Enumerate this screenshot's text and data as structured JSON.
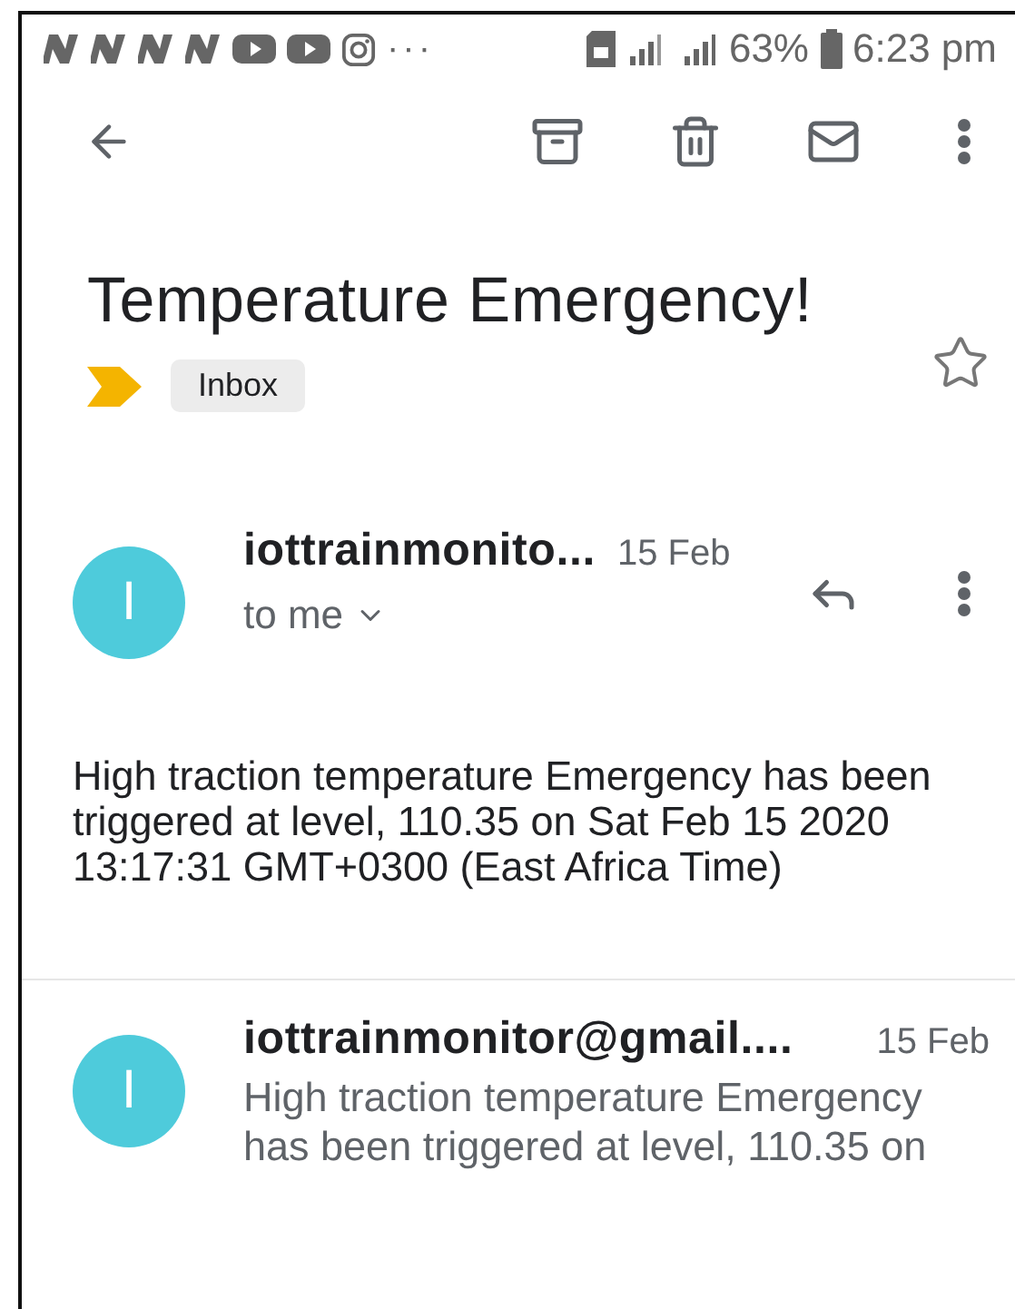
{
  "status_bar": {
    "overflow": "···",
    "battery": "63%",
    "time": "6:23 pm"
  },
  "subject": {
    "title": "Temperature Emergency!",
    "starred": false,
    "label": "Inbox"
  },
  "messages": [
    {
      "kind": "expanded",
      "avatar": "I",
      "sender": "iottrainmonito...",
      "date": "15 Feb",
      "recipient": "to me",
      "body": "High traction temperature Emergency has been triggered at level, 110.35 on Sat Feb 15 2020 13:17:31 GMT+0300 (East Africa Time)"
    },
    {
      "kind": "collapsed",
      "avatar": "I",
      "sender": "iottrainmonitor@gmail....",
      "date": "15 Feb",
      "snippet": "High traction temperature Emergency has been triggered at level, 110.35 on"
    }
  ]
}
